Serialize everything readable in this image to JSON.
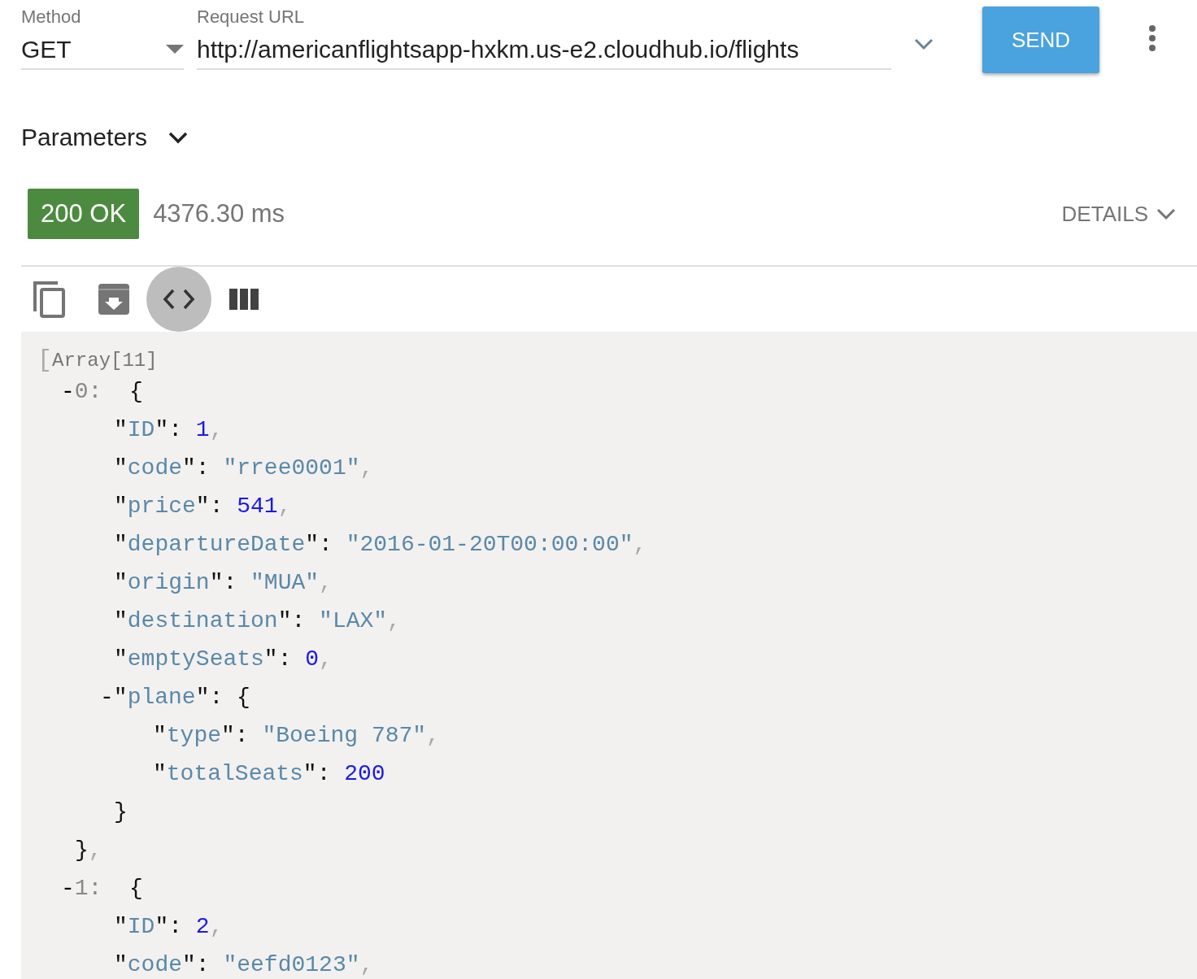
{
  "request": {
    "method": {
      "label": "Method",
      "value": "GET"
    },
    "url": {
      "label": "Request URL",
      "value": "http://americanflightsapp-hxkm.us-e2.cloudhub.io/flights"
    },
    "send": "SEND"
  },
  "parameters": {
    "label": "Parameters",
    "expanded": false
  },
  "status": {
    "badge": "200 OK",
    "time": "4376.30 ms",
    "details": "DETAILS"
  },
  "toolbar": [
    {
      "kind": "copy",
      "selected": false
    },
    {
      "kind": "save",
      "selected": false
    },
    {
      "kind": "code",
      "selected": true
    },
    {
      "kind": "columns",
      "selected": false
    }
  ],
  "response": {
    "header": [
      {
        "kind": "bracket",
        "text": "["
      },
      {
        "kind": "label",
        "text": "Array[11]"
      }
    ],
    "items": [
      {
        "tokens": [
          {
            "kind": "toggle",
            "text": "-"
          },
          {
            "kind": "index",
            "text": "0:"
          },
          {
            "kind": "punct",
            "text": "  {"
          }
        ],
        "children": [
          {
            "tokens": [
              {
                "kind": "punct",
                "text": "\""
              },
              {
                "kind": "key",
                "text": "ID"
              },
              {
                "kind": "punct",
                "text": "\": "
              },
              {
                "kind": "number",
                "text": "1"
              },
              {
                "kind": "comma",
                "text": ","
              }
            ]
          },
          {
            "tokens": [
              {
                "kind": "punct",
                "text": "\""
              },
              {
                "kind": "key",
                "text": "code"
              },
              {
                "kind": "punct",
                "text": "\": "
              },
              {
                "kind": "string",
                "text": "\"rree0001\""
              },
              {
                "kind": "comma",
                "text": ","
              }
            ]
          },
          {
            "tokens": [
              {
                "kind": "punct",
                "text": "\""
              },
              {
                "kind": "key",
                "text": "price"
              },
              {
                "kind": "punct",
                "text": "\": "
              },
              {
                "kind": "number",
                "text": "541"
              },
              {
                "kind": "comma",
                "text": ","
              }
            ]
          },
          {
            "tokens": [
              {
                "kind": "punct",
                "text": "\""
              },
              {
                "kind": "key",
                "text": "departureDate"
              },
              {
                "kind": "punct",
                "text": "\": "
              },
              {
                "kind": "string",
                "text": "\"2016-01-20T00:00:00\""
              },
              {
                "kind": "comma",
                "text": ","
              }
            ]
          },
          {
            "tokens": [
              {
                "kind": "punct",
                "text": "\""
              },
              {
                "kind": "key",
                "text": "origin"
              },
              {
                "kind": "punct",
                "text": "\": "
              },
              {
                "kind": "string",
                "text": "\"MUA\""
              },
              {
                "kind": "comma",
                "text": ","
              }
            ]
          },
          {
            "tokens": [
              {
                "kind": "punct",
                "text": "\""
              },
              {
                "kind": "key",
                "text": "destination"
              },
              {
                "kind": "punct",
                "text": "\": "
              },
              {
                "kind": "string",
                "text": "\"LAX\""
              },
              {
                "kind": "comma",
                "text": ","
              }
            ]
          },
          {
            "tokens": [
              {
                "kind": "punct",
                "text": "\""
              },
              {
                "kind": "key",
                "text": "emptySeats"
              },
              {
                "kind": "punct",
                "text": "\": "
              },
              {
                "kind": "number",
                "text": "0"
              },
              {
                "kind": "comma",
                "text": ","
              }
            ]
          },
          {
            "tokens": [
              {
                "kind": "toggle",
                "text": "-"
              },
              {
                "kind": "punct",
                "text": "\""
              },
              {
                "kind": "key",
                "text": "plane"
              },
              {
                "kind": "punct",
                "text": "\": {"
              }
            ],
            "children": [
              {
                "tokens": [
                  {
                    "kind": "punct",
                    "text": "\""
                  },
                  {
                    "kind": "key",
                    "text": "type"
                  },
                  {
                    "kind": "punct",
                    "text": "\": "
                  },
                  {
                    "kind": "string",
                    "text": "\"Boeing 787\""
                  },
                  {
                    "kind": "comma",
                    "text": ","
                  }
                ]
              },
              {
                "tokens": [
                  {
                    "kind": "punct",
                    "text": "\""
                  },
                  {
                    "kind": "key",
                    "text": "totalSeats"
                  },
                  {
                    "kind": "punct",
                    "text": "\": "
                  },
                  {
                    "kind": "number",
                    "text": "200"
                  }
                ]
              }
            ],
            "close": [
              {
                "kind": "punct",
                "text": "}"
              }
            ]
          }
        ],
        "close": [
          {
            "kind": "punct",
            "text": "}"
          },
          {
            "kind": "comma",
            "text": ","
          }
        ]
      },
      {
        "tokens": [
          {
            "kind": "toggle",
            "text": "-"
          },
          {
            "kind": "index",
            "text": "1:"
          },
          {
            "kind": "punct",
            "text": "  {"
          }
        ],
        "children": [
          {
            "tokens": [
              {
                "kind": "punct",
                "text": "\""
              },
              {
                "kind": "key",
                "text": "ID"
              },
              {
                "kind": "punct",
                "text": "\": "
              },
              {
                "kind": "number",
                "text": "2"
              },
              {
                "kind": "comma",
                "text": ","
              }
            ]
          },
          {
            "tokens": [
              {
                "kind": "punct",
                "text": "\""
              },
              {
                "kind": "key",
                "text": "code"
              },
              {
                "kind": "punct",
                "text": "\": "
              },
              {
                "kind": "string",
                "text": "\"eefd0123\""
              },
              {
                "kind": "comma",
                "text": ","
              }
            ]
          }
        ]
      }
    ]
  }
}
